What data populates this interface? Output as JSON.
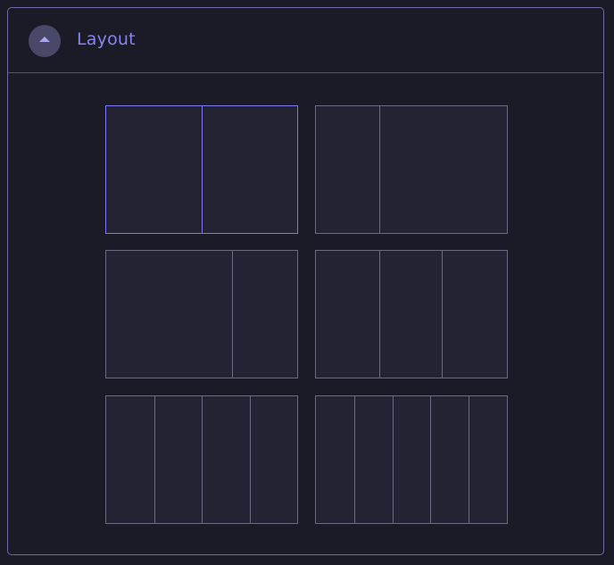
{
  "section": {
    "title": "Layout",
    "toggle_icon": "chevron-up-icon",
    "expanded": true
  },
  "colors": {
    "accent": "#8884f0",
    "border": "#6c6a80",
    "background": "#1b1b28"
  },
  "layout_options": [
    {
      "id": "two-equal",
      "columns": [
        50,
        50
      ],
      "selected": true
    },
    {
      "id": "narrow-wide",
      "columns": [
        33,
        67
      ],
      "selected": false
    },
    {
      "id": "wide-narrow",
      "columns": [
        66,
        34
      ],
      "selected": false
    },
    {
      "id": "three-equal",
      "columns": [
        33,
        33,
        34
      ],
      "selected": false
    },
    {
      "id": "four-equal",
      "columns": [
        25,
        25,
        25,
        25
      ],
      "selected": false
    },
    {
      "id": "five-equal",
      "columns": [
        20,
        20,
        20,
        20,
        20
      ],
      "selected": false
    }
  ]
}
